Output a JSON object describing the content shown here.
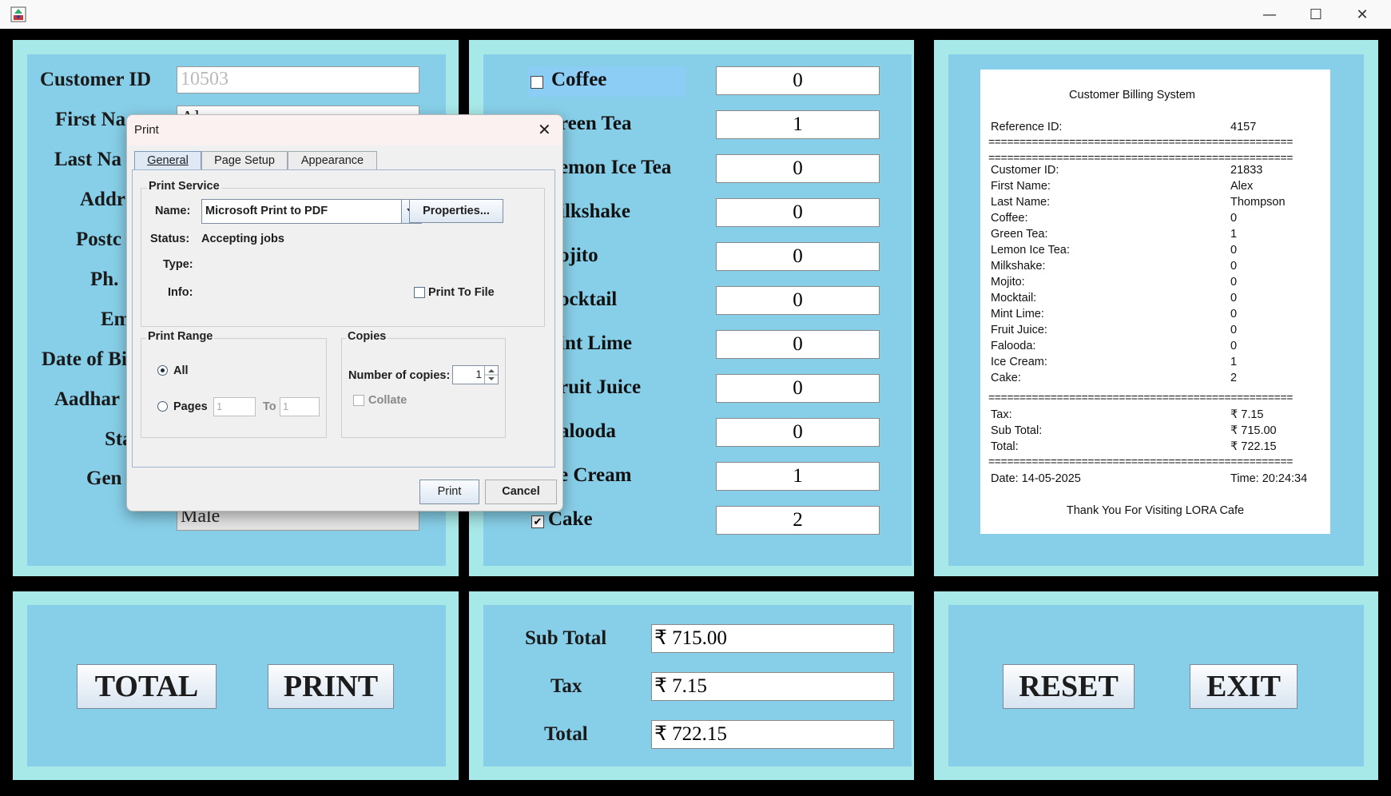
{
  "window": {
    "minimize_icon": "—",
    "maximize_icon": "☐",
    "close_icon": "✕"
  },
  "customer": {
    "labels": [
      "Customer ID",
      "First Na",
      "Last Na",
      "Addr",
      "Postc",
      "Ph.",
      "Em",
      "Date of Bi",
      "Aadhar",
      "Sta",
      "Gen"
    ],
    "customer_id": "10503",
    "first_name_partial": "Al",
    "gender": "Male"
  },
  "items": [
    {
      "label": "Coffee",
      "qty": "0",
      "checked": false
    },
    {
      "label": "reen Tea",
      "qty": "1"
    },
    {
      "label": "emon Ice Tea",
      "qty": "0"
    },
    {
      "label": "ilkshake",
      "qty": "0"
    },
    {
      "label": "ojito",
      "qty": "0"
    },
    {
      "label": "ocktail",
      "qty": "0"
    },
    {
      "label": "int Lime",
      "qty": "0"
    },
    {
      "label": "ruit Juice",
      "qty": "0"
    },
    {
      "label": "alooda",
      "qty": "0"
    },
    {
      "label": "e Cream",
      "qty": "1"
    },
    {
      "label": "Cake",
      "qty": "2",
      "checked": true
    }
  ],
  "receipt": {
    "title": "Customer Billing System",
    "reference_label": "Reference ID:",
    "reference_value": "4157",
    "separator": "=================================================",
    "rows": [
      {
        "label": "Customer ID:",
        "value": "21833"
      },
      {
        "label": "First Name:",
        "value": "Alex"
      },
      {
        "label": "Last Name:",
        "value": "Thompson"
      },
      {
        "label": "Coffee:",
        "value": "0"
      },
      {
        "label": "Green Tea:",
        "value": "1"
      },
      {
        "label": "Lemon Ice Tea:",
        "value": "0"
      },
      {
        "label": "Milkshake:",
        "value": "0"
      },
      {
        "label": "Mojito:",
        "value": "0"
      },
      {
        "label": "Mocktail:",
        "value": "0"
      },
      {
        "label": "Mint Lime:",
        "value": "0"
      },
      {
        "label": "Fruit Juice:",
        "value": "0"
      },
      {
        "label": "Falooda:",
        "value": "0"
      },
      {
        "label": "Ice Cream:",
        "value": "1"
      },
      {
        "label": "Cake:",
        "value": "2"
      }
    ],
    "totals": [
      {
        "label": "Tax:",
        "value": "₹ 7.15"
      },
      {
        "label": "Sub Total:",
        "value": "₹ 715.00"
      },
      {
        "label": "Total:",
        "value": "₹ 722.15"
      }
    ],
    "date": "Date: 14-05-2025",
    "time": "Time: 20:24:34",
    "footer": "Thank You For Visiting LORA Cafe"
  },
  "buttons": {
    "total": "TOTAL",
    "print": "PRINT",
    "reset": "RESET",
    "exit": "EXIT"
  },
  "totals": {
    "subtotal_label": "Sub Total",
    "subtotal_value": "₹ 715.00",
    "tax_label": "Tax",
    "tax_value": "₹ 7.15",
    "total_label": "Total",
    "total_value": "₹ 722.15"
  },
  "print_dialog": {
    "title": "Print",
    "close_icon": "✕",
    "tabs": {
      "general": "General",
      "page_setup": "Page Setup",
      "appearance": "Appearance"
    },
    "print_service_title": "Print Service",
    "name_label": "Name:",
    "name_value": "Microsoft Print to PDF",
    "properties_button": "Properties...",
    "status_label": "Status:",
    "status_value": "Accepting jobs",
    "type_label": "Type:",
    "info_label": "Info:",
    "print_to_file": "Print To File",
    "print_range_title": "Print Range",
    "all_label": "All",
    "pages_label": "Pages",
    "pages_from": "1",
    "to_label": "To",
    "pages_to": "1",
    "copies_title": "Copies",
    "copies_label": "Number of copies:",
    "copies_value": "1",
    "collate_label": "Collate",
    "print_button": "Print",
    "cancel_button": "Cancel"
  }
}
